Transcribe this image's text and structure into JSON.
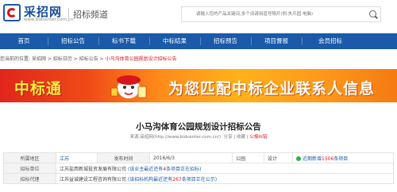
{
  "header": {
    "logo_text": "采招网",
    "logo_url": "www.bidcenter.com.cn",
    "channel": "招标频道",
    "search_placeholder": "请输入您的产品关键词,多个词请用逗号隔开(例:失乐园 电脑)"
  },
  "nav": {
    "items": [
      "首页",
      "招标公告",
      "标书下载",
      "中标结果",
      "招标预告",
      "项目督报",
      "会员招标"
    ]
  },
  "breadcrumb": {
    "parts": [
      "您当前的位置:",
      "采招网",
      ">",
      "招标日历",
      ">",
      "招标公告",
      ">"
    ],
    "current": "小马沟体育公园规划设计招标公告"
  },
  "banner": {
    "title": "中标通",
    "slogan": "为您匹配中标企业联系人信息"
  },
  "announcement": {
    "title": "小马沟体育公园规划设计招标公告",
    "source_label": "来源:采招网(",
    "source_url": "http://www.bidcenter.com.cn/",
    "source_end": ")",
    "share_label": "分享",
    "pipe": "|",
    "bookmark_label": "收藏",
    "report_label": "公报纠错"
  },
  "table": {
    "region_label": "所属地区",
    "region_value": "江苏",
    "date_label": "发布时间",
    "date_value": "2016/6/3",
    "type_value": "公园",
    "type2_value": "设计",
    "recent_text": "近期新增",
    "recent_count": "1506",
    "recent_unit": "条项目",
    "tenderer_label": "招标单位",
    "tenderer_value": "江苏盐西新城投资发展有限公司",
    "tenderer_note_prefix": "(该业主最近还有",
    "tenderer_note_count": "4",
    "tenderer_note_suffix": "条项目正在招标)",
    "agency_label": "招标代理",
    "agency_value": "江苏益诚建设工程咨询有限公司",
    "agency_note_prefix": "(该招标机构最近还有",
    "agency_note_count": "267",
    "agency_note_suffix": "条项目正在公示)"
  }
}
